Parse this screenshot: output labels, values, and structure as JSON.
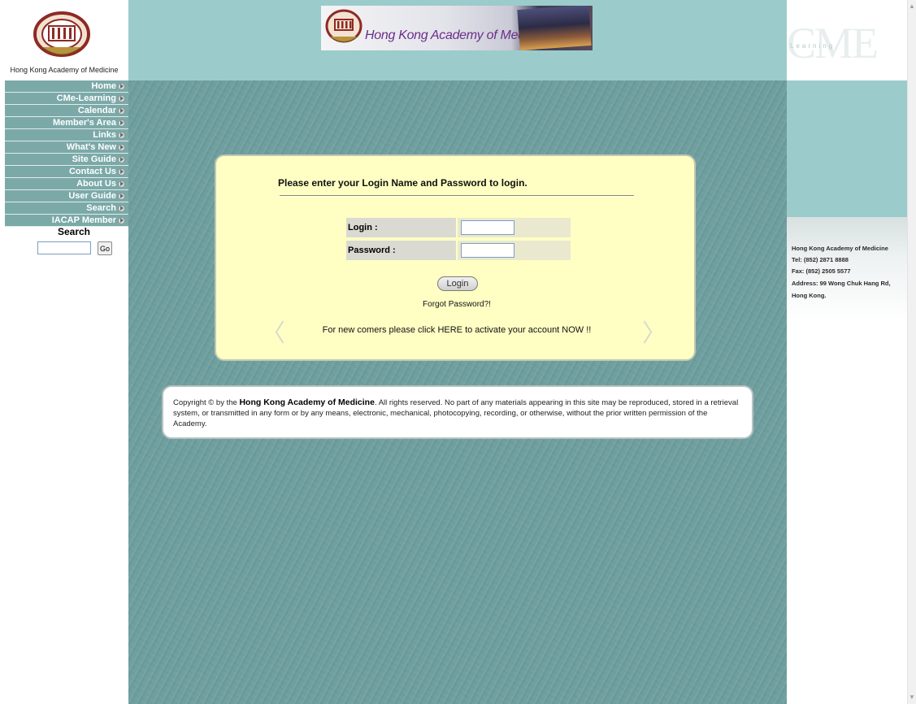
{
  "header": {
    "org_name": "Hong Kong Academy of Medicine",
    "banner_title": "Hong Kong Academy of Medicine",
    "cme_logo": "CME",
    "cme_logo_sub": "Learning"
  },
  "nav": {
    "items": [
      {
        "label": "Home"
      },
      {
        "label": "CMe-Learning"
      },
      {
        "label": "Calendar"
      },
      {
        "label": "Member's Area"
      },
      {
        "label": "Links"
      },
      {
        "label": "What's New"
      },
      {
        "label": "Site Guide"
      },
      {
        "label": "Contact Us"
      },
      {
        "label": "About Us"
      },
      {
        "label": "User Guide"
      },
      {
        "label": "Search"
      },
      {
        "label": "IACAP Member"
      }
    ]
  },
  "search": {
    "title": "Search",
    "value": "",
    "button_label": "Go"
  },
  "login": {
    "heading": "Please enter your Login Name and Password to login.",
    "login_label": "Login :",
    "login_value": "",
    "password_label": "Password :",
    "password_value": "",
    "button_label": "Login",
    "forgot_link": "Forgot Password?!",
    "newcomer_text": "For new comers please click HERE to activate your account NOW !!"
  },
  "copyright": {
    "prefix": "Copyright © by the ",
    "org": "Hong Kong Academy of Medicine",
    "suffix": ". All rights reserved. No part of any materials appearing in this site may be reproduced, stored in a retrieval system, or transmitted in any form or by any means, electronic, mechanical, photocopying, recording, or otherwise, without the prior written permission of the Academy."
  },
  "contact": {
    "name": "Hong Kong Academy of Medicine",
    "tel": "Tel:  (852) 2871 8888",
    "fax": "Fax: (852) 2505 5577",
    "address_line1": "Address: 99 Wong Chuk Hang Rd,",
    "address_line2": "Hong Kong."
  },
  "colors": {
    "header_band": "#9ccbcb",
    "content_bg": "#70a0a0",
    "nav_bg": "#7ba9a8",
    "login_card_bg": "#ffffc4",
    "banner_text": "#6b2e8a"
  }
}
